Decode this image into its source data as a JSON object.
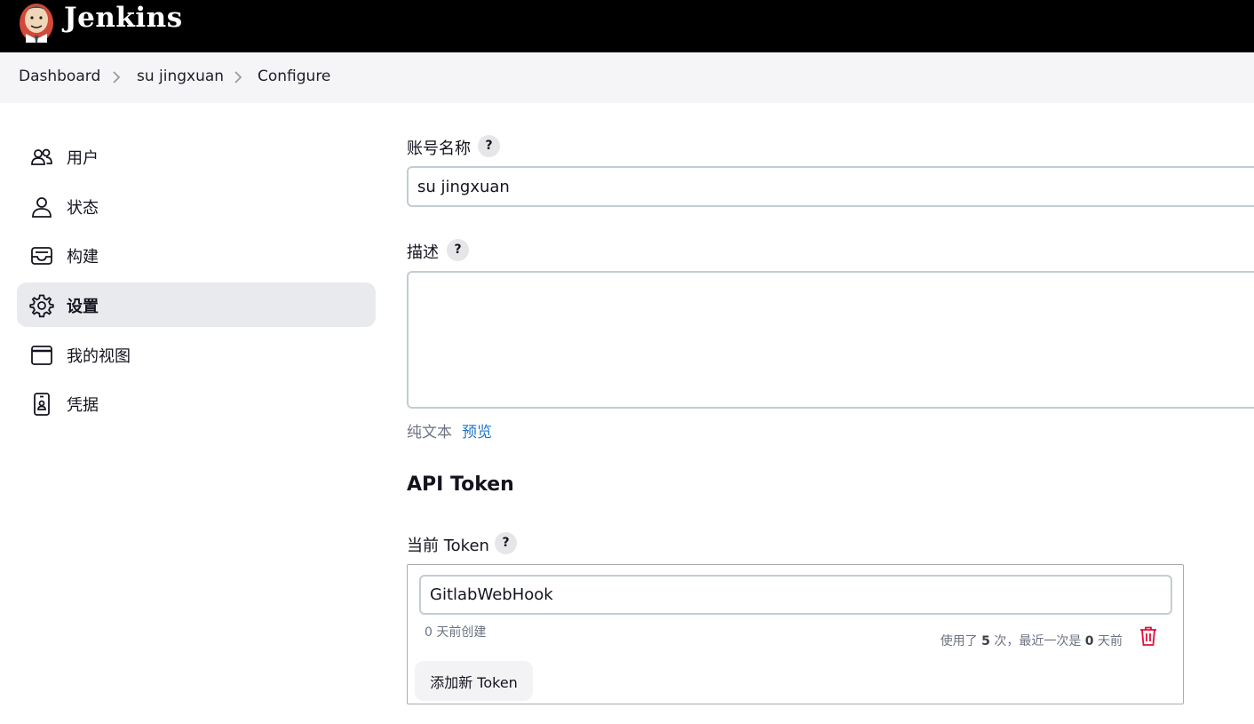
{
  "header": {
    "brand": "Jenkins",
    "logo_icon": "jenkins-butler-logo"
  },
  "breadcrumb": [
    "Dashboard",
    "su jingxuan",
    "Configure"
  ],
  "sidebar": {
    "items": [
      {
        "label": "用户",
        "icon": "users-icon"
      },
      {
        "label": "状态",
        "icon": "person-icon"
      },
      {
        "label": "构建",
        "icon": "inbox-icon"
      },
      {
        "label": "设置",
        "icon": "gear-icon",
        "active": true
      },
      {
        "label": "我的视图",
        "icon": "window-icon"
      },
      {
        "label": "凭据",
        "icon": "id-card-icon"
      }
    ]
  },
  "form": {
    "account_name": {
      "label": "账号名称",
      "help": "?",
      "value": "su jingxuan"
    },
    "description": {
      "label": "描述",
      "help": "?",
      "value": "",
      "format_text": "纯文本",
      "preview_link": "预览"
    }
  },
  "api_token": {
    "title": "API Token",
    "current_label": "当前 Token",
    "help": "?",
    "token": {
      "name": "GitlabWebHook",
      "created": "0 天前创建",
      "usage_prefix": "使用了",
      "usage_count": "5",
      "usage_middle": "次，最近一次是",
      "last_used_days": "0",
      "usage_suffix": "天前"
    },
    "add_button": "添加新 Token"
  },
  "colors": {
    "accent_link": "#1f74c9",
    "delete_icon": "#e0103c",
    "header_bg": "#000000",
    "active_item_bg": "#e9eaee"
  }
}
